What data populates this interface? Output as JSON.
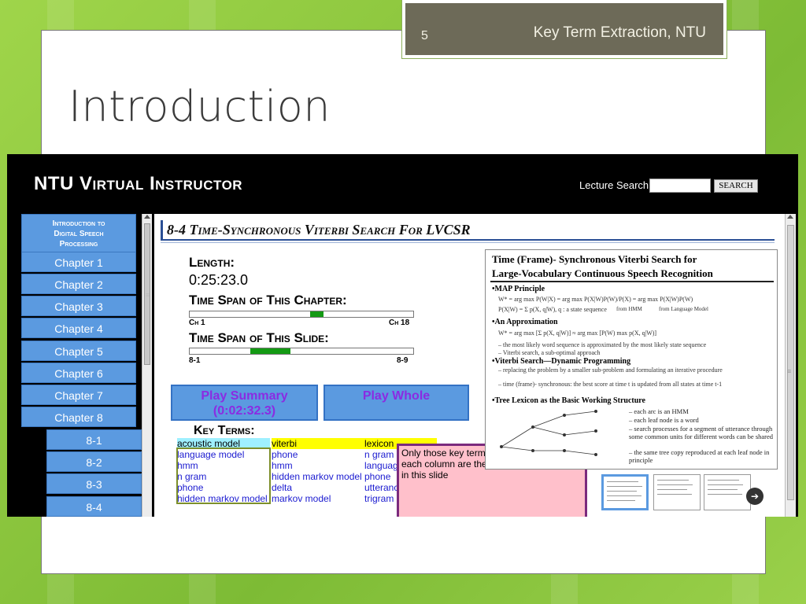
{
  "slide": {
    "number": "5",
    "header_title": "Key Term Extraction, NTU",
    "title": "Introduction"
  },
  "app": {
    "brand": "NTU Virtual Instructor",
    "search": {
      "label": "Lecture Search:",
      "value": "",
      "button": "SEARCH"
    },
    "nav": {
      "intro_lines": [
        "Introduction to",
        "Digital Speech",
        "Processing"
      ],
      "chapters": [
        "Chapter 1",
        "Chapter 2",
        "Chapter 3",
        "Chapter 4",
        "Chapter 5",
        "Chapter 6",
        "Chapter 7",
        "Chapter 8"
      ],
      "subsections": [
        "8-1",
        "8-2",
        "8-3",
        "8-4"
      ]
    },
    "section_title": "8-4 Time-Synchronous Viterbi Search For LVCSR",
    "length": {
      "label": "Length:",
      "value": "0:25:23.0"
    },
    "chapter_span": {
      "label": "Time Span of This Chapter:",
      "start": "Ch 1",
      "end": "Ch 18",
      "position_fraction": 0.54,
      "width_fraction": 0.06
    },
    "slide_span": {
      "label": "Time Span of This Slide:",
      "start": "8-1",
      "end": "8-9",
      "position_fraction": 0.27,
      "width_fraction": 0.18
    },
    "buttons": {
      "play_summary": "Play Summary",
      "play_summary_time": "(0:02:32.3)",
      "play_whole": "Play Whole"
    },
    "key_terms": {
      "title": "Key Terms:",
      "columns": [
        [
          "acoustic model",
          "language model",
          "hmm",
          "n gram",
          "phone",
          "hidden markov model"
        ],
        [
          "viterbi",
          "phone",
          "hmm",
          "hidden markov model",
          "delta",
          "markov model"
        ],
        [
          "lexicon",
          "n gram",
          "languag",
          "phone",
          "utteranc",
          "trigram"
        ]
      ]
    },
    "tooltip": "Only those key terms in black on the top of each column are the key terms appearing in this slide",
    "lecture_slide": {
      "title_line1": "Time (Frame)- Synchronous Viterbi Search for",
      "title_line2": "Large-Vocabulary Continuous Speech Recognition",
      "map_principle": "•MAP Principle",
      "approximation": "•An Approximation",
      "approx_b1": "– the most likely word sequence is approximated by the most likely state sequence",
      "approx_b2": "– Viterbi search, a sub-optimal approach",
      "viterbi_dp": "•Viterbi Search—Dynamic Programming",
      "dp_b1": "– replacing the problem by a smaller sub-problem and formulating an iterative procedure",
      "dp_b2": "– time (frame)- synchronous: the best score at time t is updated from all states at time t-1",
      "tree_lexicon": "•Tree Lexicon as the Basic Working Structure",
      "tree_b1": "– each arc is an HMM",
      "tree_b2": "– each leaf node is a word",
      "tree_b3": "– search processes for a segment of utterance through some common units for different words can be shared",
      "tree_b4": "– the same tree copy reproduced at each leaf node in principle",
      "formula1": "W* = arg max P(W|X) = arg max P(X|W)P(W)/P(X) = arg max P(X|W)P(W)",
      "formula1_from1": "from HMM",
      "formula1_from2": "from Language Model",
      "formula2": "P(X|W) = Σ p(X, q|W), q : a state sequence",
      "formula3": "W* = arg max [Σ p(X, q|W)] ≈ arg max [P(W) max p(X, q|W)]"
    }
  }
}
